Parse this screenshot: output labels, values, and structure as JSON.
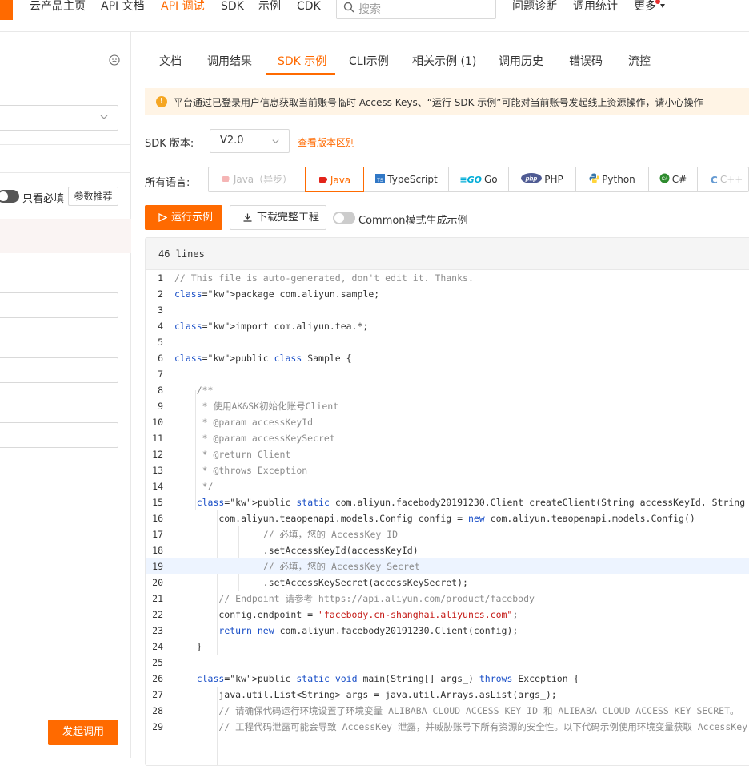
{
  "nav": {
    "items": [
      "云产品主页",
      "API 文档",
      "API 调试",
      "SDK",
      "示例",
      "CDK"
    ],
    "active": "API 调试",
    "search_placeholder": "搜索",
    "right_items": [
      "问题诊断",
      "调用统计",
      "更多"
    ]
  },
  "left": {
    "toggle_label": "只看必填",
    "param_button": "参数推荐",
    "invoke_button": "发起调用"
  },
  "tabs": [
    "文档",
    "调用结果",
    "SDK 示例",
    "CLI示例",
    "相关示例 (1)",
    "调用历史",
    "错误码",
    "流控"
  ],
  "active_tab": "SDK 示例",
  "notice": "平台通过已登录用户信息获取当前账号临时 Access Keys、“运行 SDK 示例”可能对当前账号发起线上资源操作，请小心操作",
  "sdk": {
    "label": "SDK 版本:",
    "version": "V2.0",
    "link": "查看版本区别"
  },
  "languages": {
    "label": "所有语言:",
    "items": [
      "Java（异步）",
      "Java",
      "TypeScript",
      "Go",
      "PHP",
      "Python",
      "C#",
      "C++"
    ],
    "active": "Java"
  },
  "actions": {
    "run": "运行示例",
    "download": "下载完整工程",
    "common_mode": "Common模式生成示例"
  },
  "code": {
    "header": "46 lines",
    "highlight_line": 19,
    "lines": [
      "// This file is auto-generated, don't edit it. Thanks.",
      "package com.aliyun.sample;",
      "",
      "import com.aliyun.tea.*;",
      "",
      "public class Sample {",
      "",
      "    /**",
      "     * 使用AK&SK初始化账号Client",
      "     * @param accessKeyId",
      "     * @param accessKeySecret",
      "     * @return Client",
      "     * @throws Exception",
      "     */",
      "    public static com.aliyun.facebody20191230.Client createClient(String accessKeyId, String accessKeySecret) throws Exception {",
      "        com.aliyun.teaopenapi.models.Config config = new com.aliyun.teaopenapi.models.Config()",
      "                // 必填，您的 AccessKey ID",
      "                .setAccessKeyId(accessKeyId)",
      "                // 必填，您的 AccessKey Secret",
      "                .setAccessKeySecret(accessKeySecret);",
      "        // Endpoint 请参考 https://api.aliyun.com/product/facebody",
      "        config.endpoint = \"facebody.cn-shanghai.aliyuncs.com\";",
      "        return new com.aliyun.facebody20191230.Client(config);",
      "    }",
      "",
      "    public static void main(String[] args_) throws Exception {",
      "        java.util.List<String> args = java.util.Arrays.asList(args_);",
      "        // 请确保代码运行环境设置了环境变量 ALIBABA_CLOUD_ACCESS_KEY_ID 和 ALIBABA_CLOUD_ACCESS_KEY_SECRET。",
      "        // 工程代码泄露可能会导致 AccessKey 泄露，并威胁账号下所有资源的安全性。以下代码示例使用环境变量获取 AccessKey 的方式进行调用，仅供参考，建议使用更安全的 STS 方式，更多鉴权访问方式请参见：https://help.aliyun.com/document_detail/378657.html"
    ]
  }
}
